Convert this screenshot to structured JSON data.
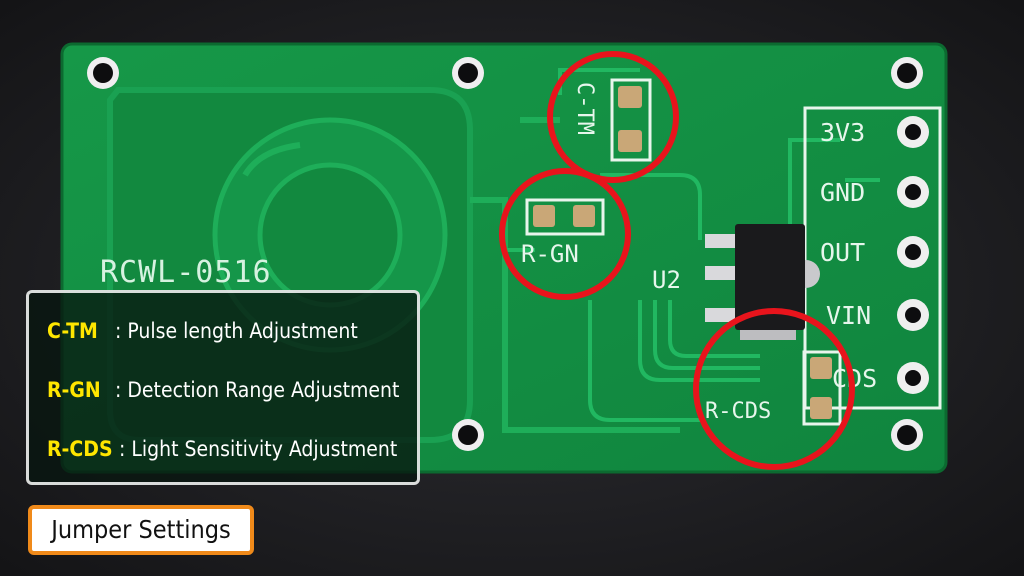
{
  "board": {
    "model_label": "RCWL-0516",
    "chip_label": "U2",
    "pin_labels": [
      "3V3",
      "GND",
      "OUT",
      "VIN",
      "CDS"
    ],
    "pads": {
      "ctm_label": "C-TM",
      "rgn_label": "R-GN",
      "rcds_label": "R-CDS"
    }
  },
  "legend": {
    "rows": [
      {
        "key": "C-TM",
        "desc": ": Pulse length Adjustment"
      },
      {
        "key": "R-GN",
        "desc": ": Detection Range Adjustment"
      },
      {
        "key": "R-CDS",
        "desc": ": Light Sensitivity Adjustment"
      }
    ]
  },
  "title": "Jumper Settings",
  "colors": {
    "pcb": "#169a4c",
    "trace": "#1fb25c",
    "highlight_circle": "#e8141c",
    "legend_key": "#ffe600",
    "title_border": "#f08a1a"
  }
}
